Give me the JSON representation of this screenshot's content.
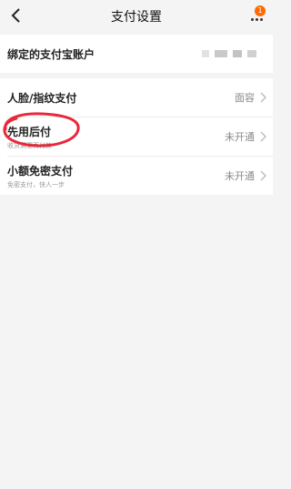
{
  "header": {
    "title": "支付设置",
    "back_icon": "chevron-left-icon",
    "more_icon": "more-dots-icon",
    "badge_count": "1",
    "badge_color": "#ff6a00"
  },
  "account_section": {
    "label": "绑定的支付宝账户"
  },
  "payment_section": {
    "items": [
      {
        "title": "人脸/指纹支付",
        "subtitle": "",
        "value": "面容"
      },
      {
        "title": "先用后付",
        "subtitle": "收货满意再付款",
        "value": "未开通"
      },
      {
        "title": "小额免密支付",
        "subtitle": "免密支付，快人一步",
        "value": "未开通"
      }
    ]
  },
  "colors": {
    "page_background": "#f4f4f4",
    "card_background": "#ffffff",
    "annotation_red": "#e8283b"
  }
}
